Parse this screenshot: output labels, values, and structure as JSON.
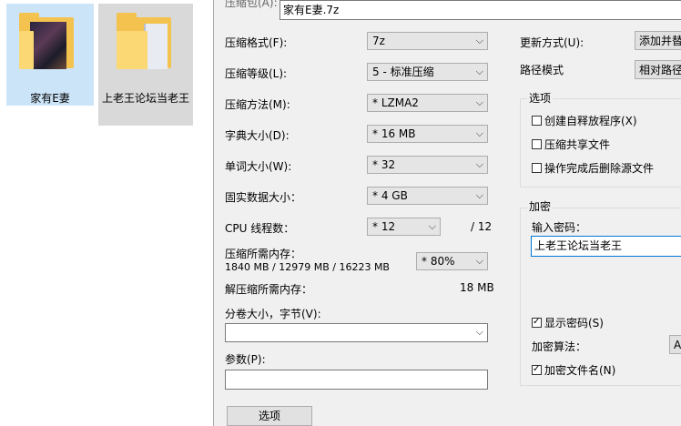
{
  "desktop": {
    "icon1_label": "家有E妻",
    "icon2_label": "上老王论坛当老王"
  },
  "dialog": {
    "archive_label": "压缩包(A):",
    "archive_value": "家有E妻.7z",
    "format_label": "压缩格式(F):",
    "format_value": "7z",
    "level_label": "压缩等级(L):",
    "level_value": "5 - 标准压缩",
    "method_label": "压缩方法(M):",
    "method_value": "* LZMA2",
    "dict_label": "字典大小(D):",
    "dict_value": "* 16 MB",
    "word_label": "单词大小(W):",
    "word_value": "* 32",
    "solid_label": "固实数据大小：",
    "solid_value": "* 4 GB",
    "cpu_label": "CPU 线程数：",
    "cpu_value": "* 12",
    "cpu_total": "/ 12",
    "mem_label": "压缩所需内存：",
    "mem_detail": "1840 MB / 12979 MB / 16223 MB",
    "mem_value": "* 80%",
    "decomp_label": "解压缩所需内存：",
    "decomp_value": "18 MB",
    "volume_label": "分卷大小，字节(V):",
    "volume_value": "",
    "params_label": "参数(P):",
    "params_value": "",
    "options_button": "选项",
    "update_label": "更新方式(U):",
    "update_value": "添加并替",
    "path_label": "路径模式",
    "path_value": "相对路径",
    "options_group": "选项",
    "opt_sfx": "创建自释放程序(X)",
    "opt_shared": "压缩共享文件",
    "opt_delete": "操作完成后删除源文件",
    "encrypt_group": "加密",
    "password_label": "输入密码：",
    "password_value": "上老王论坛当老王",
    "show_password": "显示密码(S)",
    "enc_method_label": "加密算法：",
    "enc_method_value": "AE",
    "enc_filenames": "加密文件名(N)"
  }
}
